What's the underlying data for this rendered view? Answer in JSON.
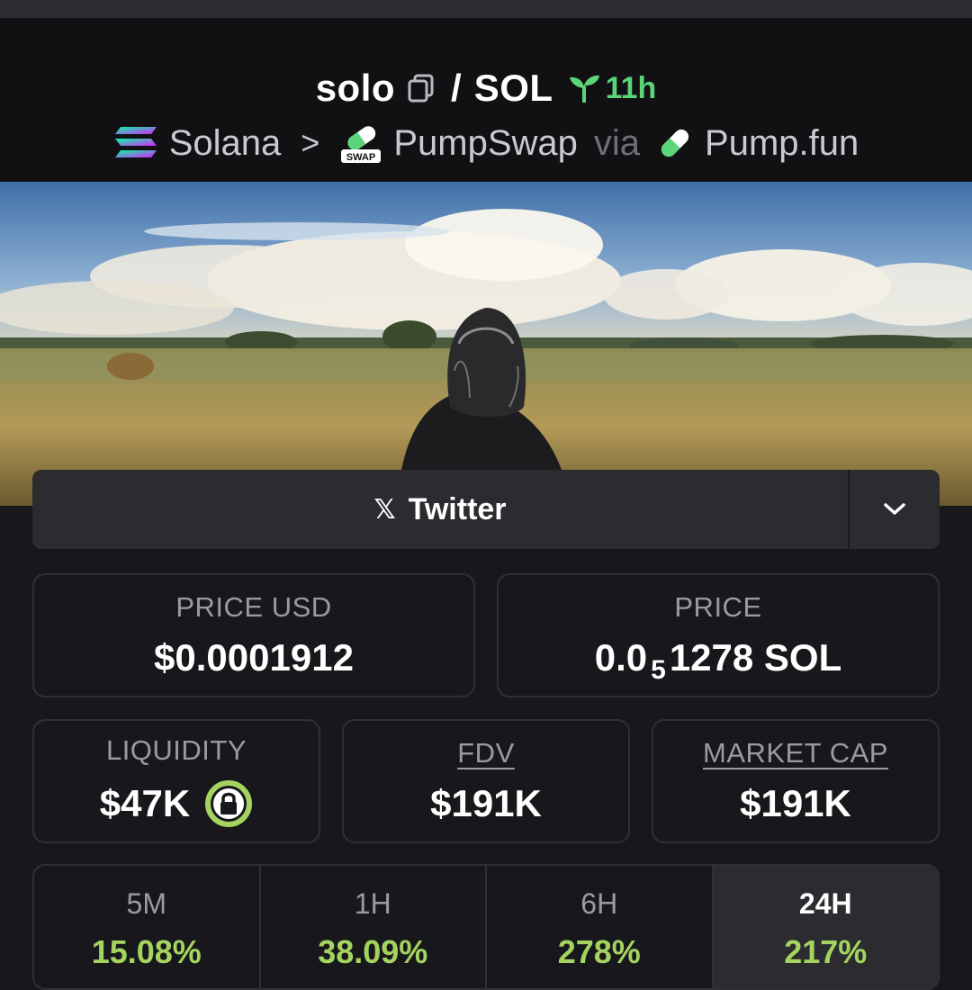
{
  "header": {
    "token_symbol": "solo",
    "quote_symbol": "SOL",
    "age": "11h",
    "chain": "Solana",
    "dex": "PumpSwap",
    "dex_badge": "SWAP",
    "via_text": "via",
    "launchpad": "Pump.fun"
  },
  "social": {
    "twitter_label": "Twitter",
    "x_glyph": "𝕏"
  },
  "stats": {
    "price_usd_label": "PRICE USD",
    "price_usd": "$0.0001912",
    "price_label": "PRICE",
    "price_native_prefix": "0.0",
    "price_native_zeros": "5",
    "price_native_digits": "1278 SOL",
    "liquidity_label": "LIQUIDITY",
    "liquidity": "$47K",
    "fdv_label": "FDV",
    "fdv": "$191K",
    "mcap_label": "MARKET CAP",
    "mcap": "$191K"
  },
  "timeframes": [
    {
      "label": "5M",
      "change": "15.08%"
    },
    {
      "label": "1H",
      "change": "38.09%"
    },
    {
      "label": "6H",
      "change": "278%"
    },
    {
      "label": "24H",
      "change": "217%"
    }
  ],
  "colors": {
    "accent_green": "#5bd47a",
    "change_green": "#a4d45f",
    "lock_green": "#a4d45f",
    "background": "#18181c"
  },
  "icons": {
    "copy": "copy-icon",
    "age": "sprout-icon",
    "chain": "solana-logo-icon",
    "dex": "pumpswap-pill-icon",
    "launchpad": "pill-icon",
    "toggle": "chevron-down-icon",
    "lock": "lock-icon"
  }
}
